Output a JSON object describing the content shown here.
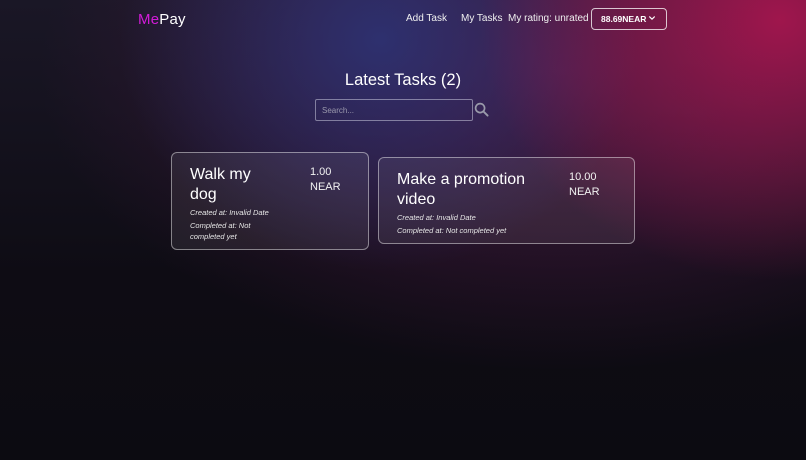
{
  "header": {
    "logo_part1": "Me",
    "logo_part2": "Pay",
    "nav": {
      "add_task": "Add Task",
      "my_tasks": "My Tasks",
      "rating": "My rating: unrated"
    },
    "wallet_balance": "88.69NEAR"
  },
  "main": {
    "title": "Latest Tasks (2)",
    "search_placeholder": "Search..."
  },
  "tasks": [
    {
      "title": "Walk my dog",
      "price": "1.00 NEAR",
      "created": "Created at: Invalid Date",
      "completed": "Completed at: Not completed yet"
    },
    {
      "title": "Make a promotion video",
      "price": "10.00 NEAR",
      "created": "Created at: Invalid Date",
      "completed": "Completed at: Not completed yet"
    }
  ],
  "colors": {
    "brand_accent": "#d21bd8",
    "background": "#0e0c14",
    "glow_magenta": "#a5164e",
    "glow_blue": "#2c3478"
  },
  "icons": [
    "chevron-down-icon",
    "search-icon"
  ]
}
